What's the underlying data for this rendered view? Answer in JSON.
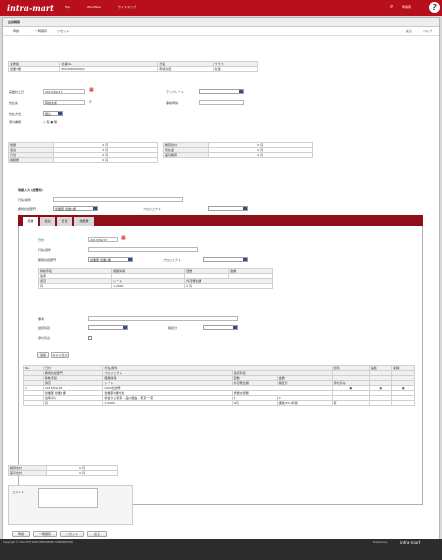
{
  "header": {
    "logo": "intra-mart",
    "menu": [
      "Top",
      "Workflow",
      "サイトマップ"
    ],
    "user": "申請者"
  },
  "page": {
    "title": "出張精算",
    "back": "戻る",
    "help": "ヘルプ"
  },
  "toolbar": {
    "apply": "申請",
    "draft": "一時保存",
    "reset": "リセット"
  },
  "applicant": {
    "h1": "主務組",
    "h2": "社員No.",
    "h3": "氏名",
    "h4": "クラス",
    "v1": "営業1課",
    "v2": "ECD400000001",
    "v3": "申請太郎",
    "v4": "社員"
  },
  "form": {
    "date_label": "実績計上日",
    "date": "2013/09/17",
    "template_label": "テンプレート",
    "applicant_label": "支払先",
    "applicant": "申請太郎",
    "purpose_label": "事前申請",
    "method_label": "支払方法",
    "method": "振込",
    "attach_label": "添付書類",
    "attach": "○ 有 ● 無"
  },
  "summary": {
    "l1": "旅費",
    "l2": "宿泊",
    "l3": "日当",
    "l4": "諸経費",
    "r1": "精算合計",
    "r2": "仮払金",
    "r3": "差引精算",
    "yen": "0 円"
  },
  "batch": {
    "title": "明細入力 (旅費明)",
    "purpose": "行先/用件",
    "dept": "費用負担部門",
    "dept_v": "営業部 営業1課",
    "project": "プロジェクト"
  },
  "tabs": [
    "旅費",
    "宿泊",
    "日当",
    "諸経費"
  ],
  "detail": {
    "date_label": "日付",
    "date": "2013/09/17",
    "purpose_label": "行先/用件",
    "dept_label": "費用負担部門",
    "dept": "営業部 営業1課",
    "project_label": "プロジェクト",
    "means_label": "移動手段",
    "route_label": "経路情報",
    "count_label": "回数",
    "amount_label": "金額",
    "means": "電車",
    "currency_label": "通貨",
    "rate_label": "レート",
    "foreign_label": "外貨発生額",
    "currency": "円",
    "rate": "1.0000",
    "foreign": "0 円",
    "note_label": "備考",
    "account_label": "勘定科目",
    "tax_label": "税区分",
    "receipt_label": "添付済み",
    "add": "追加",
    "cancel": "キャンセル"
  },
  "table": {
    "h": [
      "No.",
      "日付",
      "行先/用件",
      "",
      "",
      "帰宅",
      "編集",
      "削除"
    ],
    "h2": [
      "",
      "費用負担部門",
      "プロジェクト",
      "勘定科目"
    ],
    "h3": [
      "",
      "移動手段",
      "経路情報",
      "回数",
      "金額"
    ],
    "h4": [
      "",
      "通貨",
      "レート",
      "外貨発生額",
      "税区分",
      "添付済み"
    ],
    "r1": [
      "1",
      "2013/09/18",
      "OOO社訪問"
    ],
    "r2": [
      "",
      "営業部 営業1課",
      "営業部1課外食",
      "旅費交通費"
    ],
    "r3": [
      "",
      "電車(片)",
      "新宿から東京 - 品川経由 - 東京 一東",
      "1",
      "0"
    ],
    "r4": [
      "",
      "円",
      "1.0000",
      "0円",
      "課税(5%)外税",
      "有"
    ]
  },
  "totals": {
    "l1": "精算合計",
    "l2": "差引合計",
    "v": "0 円"
  },
  "comment": {
    "label": "コメント"
  },
  "bottom": {
    "apply": "申請",
    "draft": "一時保存",
    "reset": "リセット",
    "back": "戻る"
  },
  "footer": {
    "copyright": "Copyright © 2012 NTT DATA INTRAMART CORPORATION",
    "powered": "Powered by",
    "brand": "intra-mart"
  }
}
